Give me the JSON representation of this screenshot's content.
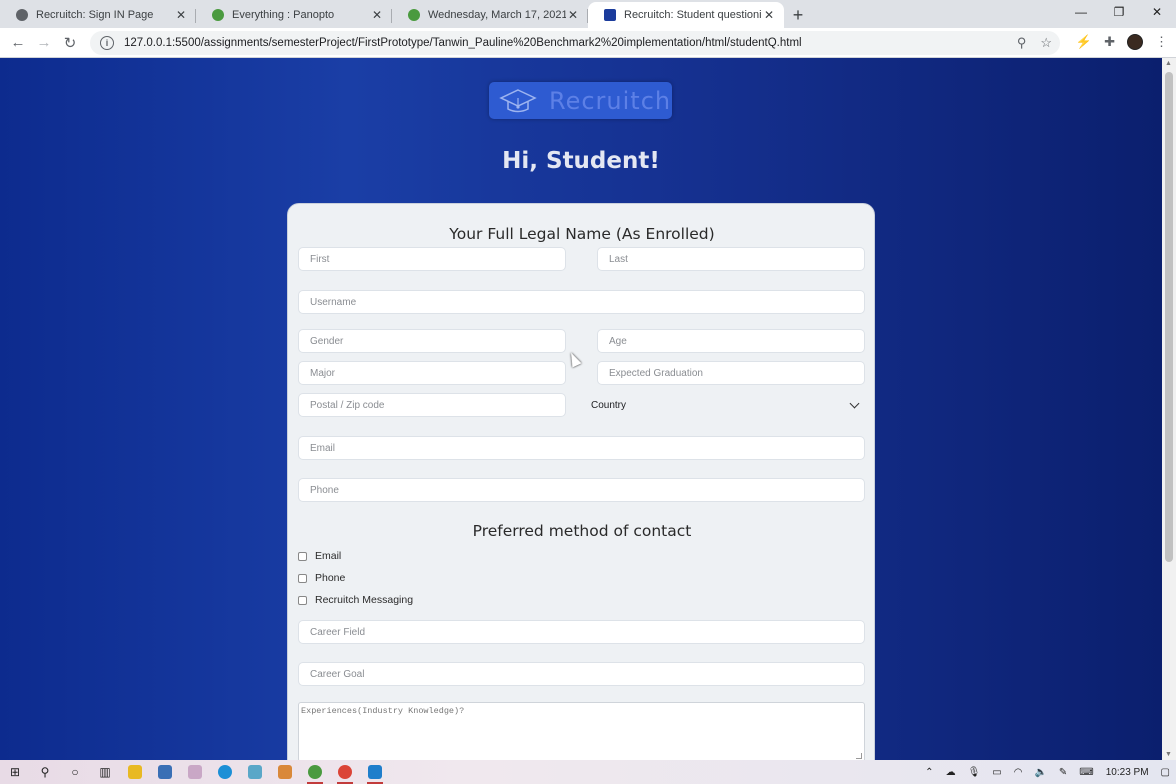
{
  "browser": {
    "tabs": [
      {
        "title": "Recruitch: Sign IN Page",
        "icon": "globe-icon",
        "active": false
      },
      {
        "title": "Everything : Panopto",
        "icon": "panopto-icon",
        "active": false
      },
      {
        "title": "Wednesday, March 17, 2021 at 1",
        "icon": "panopto-icon",
        "active": false
      },
      {
        "title": "Recruitch: Student questioniere",
        "icon": "page-icon",
        "active": true
      }
    ],
    "url": "127.0.0.1:5500/assignments/semesterProject/FirstPrototype/Tanwin_Pauline%20Benchmark2%20implementation/html/studentQ.html"
  },
  "page": {
    "logo_text": "Recruitch",
    "greeting": "Hi, Student!",
    "name_section_title": "Your Full Legal Name (As Enrolled)",
    "placeholders": {
      "first": "First",
      "last": "Last",
      "username": "Username",
      "gender": "Gender",
      "age": "Age",
      "major": "Major",
      "graduation": "Expected Graduation",
      "postal": "Postal / Zip code",
      "email": "Email",
      "phone": "Phone",
      "career_field": "Career Field",
      "career_goal": "Career Goal",
      "experiences": "Experiences(Industry Knowledge)?"
    },
    "country_select": "Country",
    "contact_section_title": "Preferred method of contact",
    "contact_options": [
      "Email",
      "Phone",
      "Recruitch Messaging"
    ]
  },
  "taskbar": {
    "time": "10:23 PM"
  },
  "colors": {
    "page_bg": "#15308f",
    "card_bg": "#eef1f4",
    "logo_bg": "#2e5bd1"
  }
}
